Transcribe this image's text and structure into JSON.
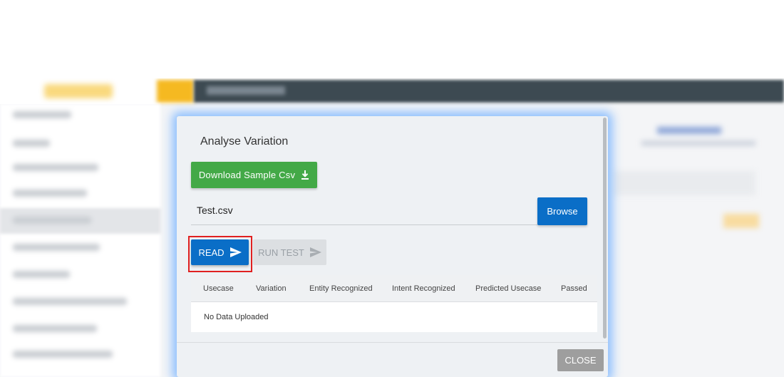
{
  "modal": {
    "title": "Analyse Variation",
    "download_label": "Download Sample Csv",
    "file_value": "Test.csv",
    "browse_label": "Browse",
    "read_label": "READ",
    "run_test_label": "RUN TEST",
    "close_label": "CLOSE"
  },
  "table": {
    "columns": [
      "Usecase",
      "Variation",
      "Entity Recognized",
      "Intent Recognized",
      "Predicted Usecase",
      "Passed"
    ],
    "empty_text": "No Data Uploaded"
  },
  "colors": {
    "download": "#43a947",
    "primary": "#0a6ec7",
    "disabled": "#dcdfe2",
    "close": "#9e9e9e",
    "highlight": "#e02020"
  }
}
